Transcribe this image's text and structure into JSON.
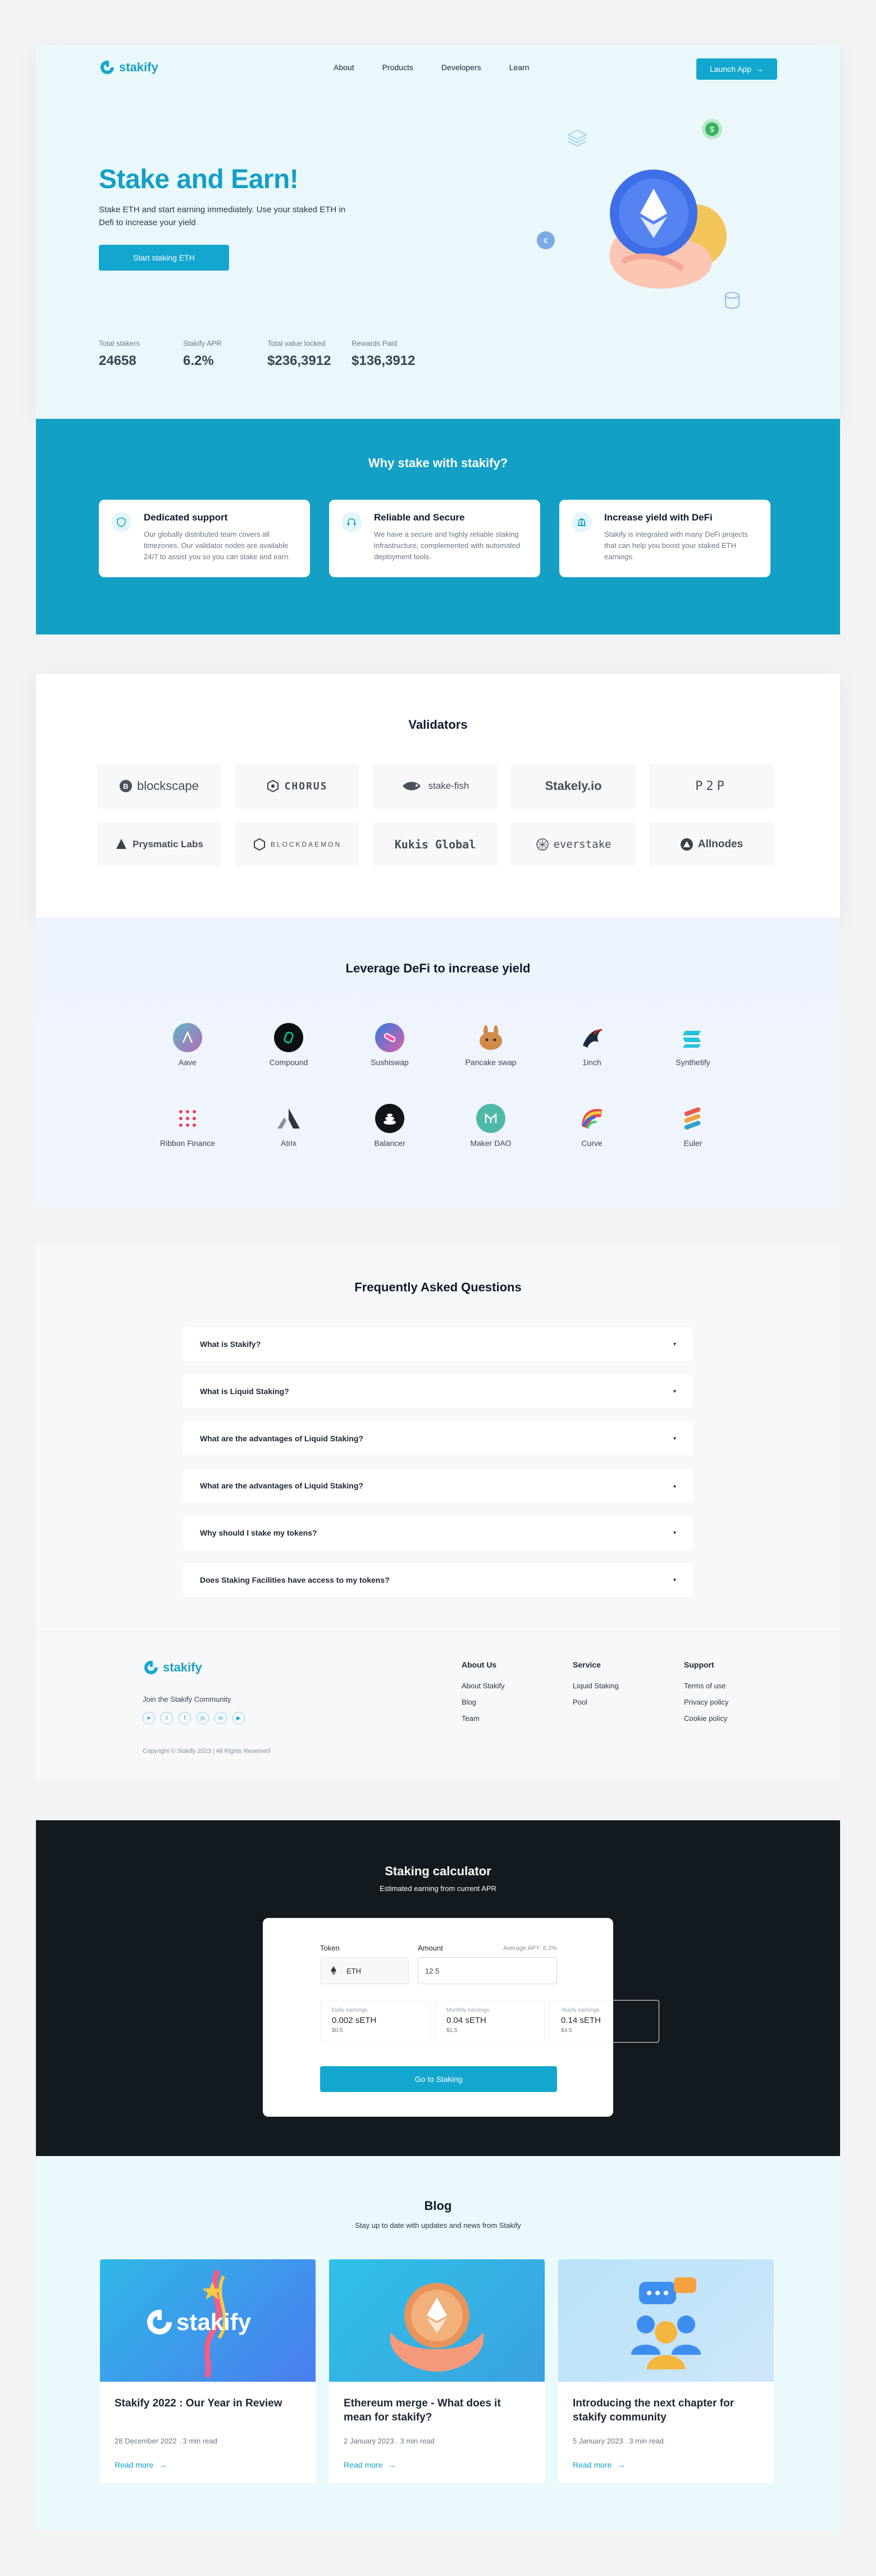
{
  "brand": {
    "name": "stakify",
    "accent": "#13a7cf"
  },
  "nav": {
    "links": [
      "About",
      "Products",
      "Developers",
      "Learn"
    ],
    "launch": "Launch App"
  },
  "hero": {
    "title": "Stake and Earn!",
    "subtitle": "Stake ETH and start earning immediately. Use your staked ETH in Defi to increase your yield",
    "cta": "Start staking ETH",
    "stats": [
      {
        "label": "Total stakers",
        "value": "24658"
      },
      {
        "label": "Stakify APR",
        "value": "6.2%"
      },
      {
        "label": "Total value locked",
        "value": "$236,3912"
      },
      {
        "label": "Rewards Paid",
        "value": "$136,3912"
      }
    ]
  },
  "why": {
    "title": "Why stake with stakify?",
    "cards": [
      {
        "icon": "shield-icon",
        "title": "Dedicated support",
        "text": "Our globally distributed team covers all timezones. Our validator nodes are available 24/7 to assist you so you can stake and earn."
      },
      {
        "icon": "headset-icon",
        "title": "Reliable and Secure",
        "text": "We have a secure and highly reliable staking infrastructure, complemented with automated deployment tools."
      },
      {
        "icon": "bank-icon",
        "title": "Increase yield with DeFi",
        "text": "Stakify is integrated with many DeFi projects that can help you boost your staked ETH earnings."
      }
    ]
  },
  "validators": {
    "title": "Validators",
    "items": [
      "blockscape",
      "CHORUS",
      "stake-fish",
      "Stakely.io",
      "P2P",
      "Prysmatic Labs",
      "BLOCKDAEMON",
      "Kukis Global",
      "everstake",
      "Allnodes"
    ]
  },
  "defi": {
    "title": "Leverage DeFi to increase yield",
    "items": [
      {
        "name": "Aave",
        "color": "#8b6fb8"
      },
      {
        "name": "Compound",
        "color": "#0b0f12"
      },
      {
        "name": "Sushiswap",
        "color": "#e05fa8"
      },
      {
        "name": "Pancake swap",
        "color": "#d18a4a"
      },
      {
        "name": "1inch",
        "color": "#1b2a3c"
      },
      {
        "name": "Synthetify",
        "color": "#23c4d9"
      },
      {
        "name": "Ribbon Finance",
        "color": "#e93f5a"
      },
      {
        "name": "Atrix",
        "color": "#2f3540"
      },
      {
        "name": "Balancer",
        "color": "#111418"
      },
      {
        "name": "Maker DAO",
        "color": "#4fb9a8"
      },
      {
        "name": "Curve",
        "color": "#f0484e"
      },
      {
        "name": "Euler",
        "color": "#e85b4e"
      }
    ]
  },
  "faq": {
    "title": "Frequently Asked Questions",
    "items": [
      {
        "q": "What is Stakify?",
        "caret": "▾"
      },
      {
        "q": "What is Liquid Staking?",
        "caret": "▾"
      },
      {
        "q": "What are the advantages of Liquid Staking?",
        "caret": "▾"
      },
      {
        "q": "What are the advantages of Liquid Staking?",
        "caret": "▴"
      },
      {
        "q": "Why should I stake my tokens?",
        "caret": "▾"
      },
      {
        "q": "Does Staking Facilities have access to my tokens?",
        "caret": "▾"
      }
    ]
  },
  "footer": {
    "join": "Join the Stakify Community",
    "socials": [
      "telegram-icon",
      "twitter-icon",
      "facebook-icon",
      "instagram-icon",
      "linkedin-icon",
      "youtube-icon"
    ],
    "copyright": "Copyright © Stakify 2023 | All Rights Reserved",
    "cols": [
      {
        "title": "About Us",
        "links": [
          "About Stakify",
          "Blog",
          "Team"
        ]
      },
      {
        "title": "Service",
        "links": [
          "Liquid Staking",
          "Pool"
        ]
      },
      {
        "title": "Support",
        "links": [
          "Terms of use",
          "Privacy policy",
          "Cookie policy"
        ]
      }
    ]
  },
  "calc": {
    "title": "Staking calculator",
    "subtitle": "Estimated earning from current APR",
    "token_label": "Token",
    "token_value": "ETH",
    "amount_label": "Amount",
    "amount_value": "12.5",
    "apy": "Average APY: 6.2%",
    "earnings": [
      {
        "label": "Daily earnings",
        "value": "0.002 sETH",
        "usd": "$0.5"
      },
      {
        "label": "Monthly earnings",
        "value": "0.04 sETH",
        "usd": "$1.5"
      },
      {
        "label": "Yearly earnings",
        "value": "0.14 sETH",
        "usd": "$4.5"
      }
    ],
    "button": "Go to Staking"
  },
  "blog": {
    "title": "Blog",
    "subtitle": "Stay up to date with updates and news from Stakify",
    "posts": [
      {
        "title": "Stakify 2022 : Our Year in Review",
        "meta": "28 December 2022 . 3 min read",
        "more": "Read more",
        "image_text": "stakify"
      },
      {
        "title": "Ethereum merge - What does it mean for stakify?",
        "meta": "2 January 2023 . 3 min read",
        "more": "Read more"
      },
      {
        "title": "Introducing the next chapter for stakify community",
        "meta": "5 January 2023 . 3 min read",
        "more": "Read more"
      }
    ]
  }
}
